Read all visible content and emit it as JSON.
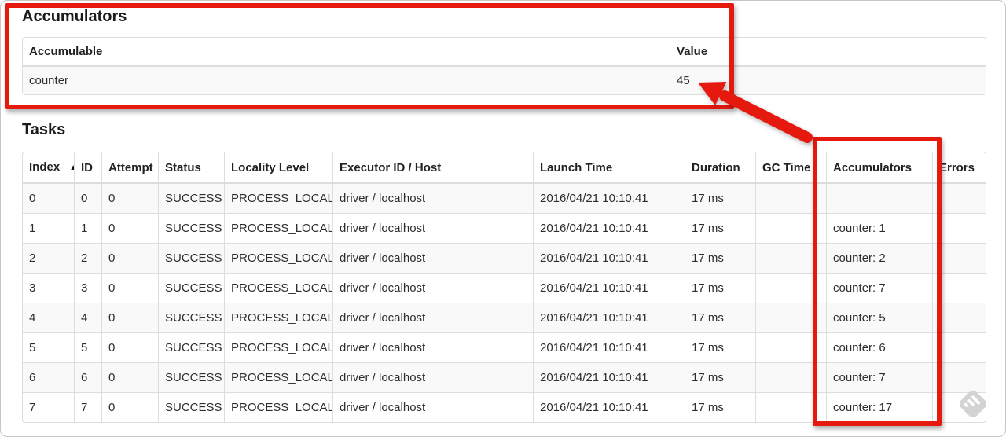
{
  "accumulators_section": {
    "title": "Accumulators",
    "table": {
      "headers": [
        "Accumulable",
        "Value"
      ],
      "rows": [
        {
          "accumulable": "counter",
          "value": "45"
        }
      ]
    }
  },
  "tasks_section": {
    "title": "Tasks",
    "table": {
      "sort_indicator": "▲",
      "columns": [
        {
          "key": "index",
          "label": "Index",
          "sorted": true
        },
        {
          "key": "id",
          "label": "ID"
        },
        {
          "key": "attempt",
          "label": "Attempt"
        },
        {
          "key": "status",
          "label": "Status"
        },
        {
          "key": "locality",
          "label": "Locality Level"
        },
        {
          "key": "executor",
          "label": "Executor ID / Host"
        },
        {
          "key": "launch",
          "label": "Launch Time"
        },
        {
          "key": "duration",
          "label": "Duration"
        },
        {
          "key": "gc",
          "label": "GC Time"
        },
        {
          "key": "accumulators",
          "label": "Accumulators"
        },
        {
          "key": "errors",
          "label": "Errors"
        }
      ],
      "rows": [
        {
          "index": "0",
          "id": "0",
          "attempt": "0",
          "status": "SUCCESS",
          "locality": "PROCESS_LOCAL",
          "executor": "driver / localhost",
          "launch": "2016/04/21 10:10:41",
          "duration": "17 ms",
          "gc": "",
          "accumulators": "",
          "errors": ""
        },
        {
          "index": "1",
          "id": "1",
          "attempt": "0",
          "status": "SUCCESS",
          "locality": "PROCESS_LOCAL",
          "executor": "driver / localhost",
          "launch": "2016/04/21 10:10:41",
          "duration": "17 ms",
          "gc": "",
          "accumulators": "counter: 1",
          "errors": ""
        },
        {
          "index": "2",
          "id": "2",
          "attempt": "0",
          "status": "SUCCESS",
          "locality": "PROCESS_LOCAL",
          "executor": "driver / localhost",
          "launch": "2016/04/21 10:10:41",
          "duration": "17 ms",
          "gc": "",
          "accumulators": "counter: 2",
          "errors": ""
        },
        {
          "index": "3",
          "id": "3",
          "attempt": "0",
          "status": "SUCCESS",
          "locality": "PROCESS_LOCAL",
          "executor": "driver / localhost",
          "launch": "2016/04/21 10:10:41",
          "duration": "17 ms",
          "gc": "",
          "accumulators": "counter: 7",
          "errors": ""
        },
        {
          "index": "4",
          "id": "4",
          "attempt": "0",
          "status": "SUCCESS",
          "locality": "PROCESS_LOCAL",
          "executor": "driver / localhost",
          "launch": "2016/04/21 10:10:41",
          "duration": "17 ms",
          "gc": "",
          "accumulators": "counter: 5",
          "errors": ""
        },
        {
          "index": "5",
          "id": "5",
          "attempt": "0",
          "status": "SUCCESS",
          "locality": "PROCESS_LOCAL",
          "executor": "driver / localhost",
          "launch": "2016/04/21 10:10:41",
          "duration": "17 ms",
          "gc": "",
          "accumulators": "counter: 6",
          "errors": ""
        },
        {
          "index": "6",
          "id": "6",
          "attempt": "0",
          "status": "SUCCESS",
          "locality": "PROCESS_LOCAL",
          "executor": "driver / localhost",
          "launch": "2016/04/21 10:10:41",
          "duration": "17 ms",
          "gc": "",
          "accumulators": "counter: 7",
          "errors": ""
        },
        {
          "index": "7",
          "id": "7",
          "attempt": "0",
          "status": "SUCCESS",
          "locality": "PROCESS_LOCAL",
          "executor": "driver / localhost",
          "launch": "2016/04/21 10:10:41",
          "duration": "17 ms",
          "gc": "",
          "accumulators": "counter: 17",
          "errors": ""
        }
      ]
    }
  },
  "annotations": {
    "color": "#e6190e",
    "shapes": [
      "box-around-accumulators-section",
      "box-around-accumulators-column",
      "arrow-from-column-to-value-45"
    ]
  },
  "watermark": {
    "icon": "feedly-diamond-icon",
    "color": "#d3d3d3"
  }
}
